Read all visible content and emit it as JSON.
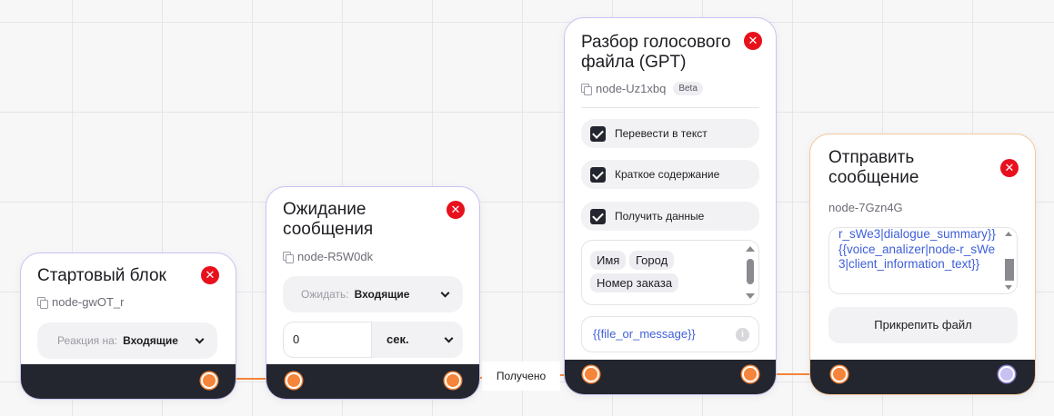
{
  "nodes": {
    "start": {
      "title": "Стартовый блок",
      "id": "node-gwOT_r",
      "reaction_label": "Реакция на:",
      "reaction_value": "Входящие"
    },
    "wait": {
      "title": "Ожидание сообщения",
      "id": "node-R5W0dk",
      "wait_label": "Ожидать:",
      "wait_value": "Входящие",
      "timeout_value": "0",
      "timeout_unit": "сек."
    },
    "voice": {
      "title": "Разбор голосового файла (GPT)",
      "id": "node-Uz1xbq",
      "badge": "Beta",
      "options": [
        {
          "label": "Перевести в текст",
          "checked": true
        },
        {
          "label": "Краткое содержание",
          "checked": true
        },
        {
          "label": "Получить данные",
          "checked": true
        }
      ],
      "tags": [
        "Имя",
        "Город",
        "Номер заказа"
      ],
      "variable": "{{file_or_message}}"
    },
    "send": {
      "title": "Отправить сообщение",
      "id": "node-7Gzn4G",
      "message_text": "r_sWe3|dialogue_summary}} {{voice_analizer|node-r_sWe3|client_information_text}}",
      "attach_label": "Прикрепить файл"
    }
  },
  "edges": {
    "received_label": "Получено"
  },
  "colors": {
    "handle": "#f5853a",
    "close": "#e8101d",
    "footer": "#23262e",
    "variable_text": "#3e5fd8"
  }
}
